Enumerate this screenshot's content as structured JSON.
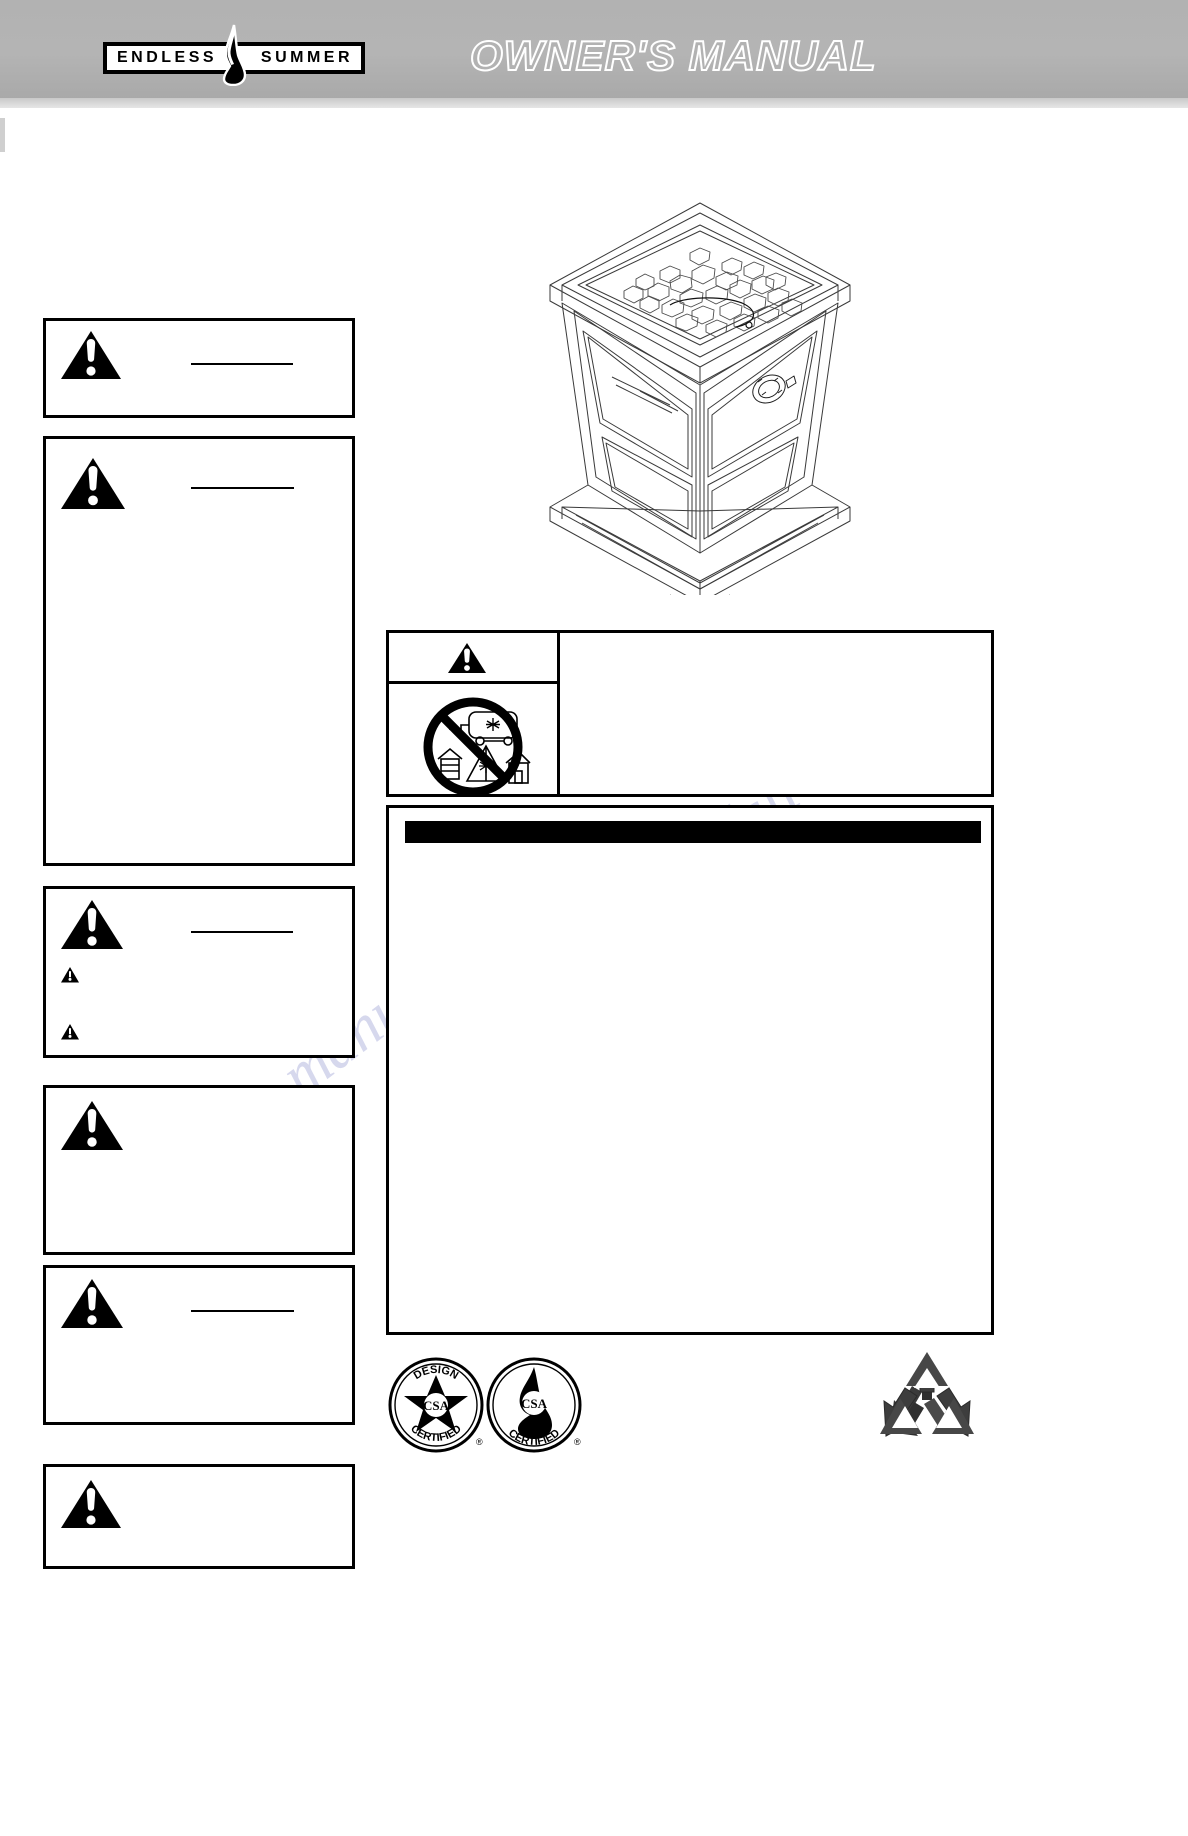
{
  "document": {
    "type": "owner-manual-cover",
    "page_background": "#ffffff"
  },
  "header": {
    "background_color": "#b2b2b2",
    "title": "OWNER'S MANUAL",
    "title_fill": "#b2b2b2",
    "title_outline": "#ffffff",
    "logo": {
      "left_word": "ENDLESS",
      "right_word": "SUMMER",
      "icon": "flame-icon",
      "box_color": "#000000",
      "text_color": "#000000"
    }
  },
  "watermark": {
    "line1": "manualslive.com",
    "line2": ".com",
    "color": "#c9cbe8"
  },
  "left_column": {
    "boxes": [
      {
        "id": "warning-box-1",
        "icon": "warning-triangle-icon",
        "heading_rule": true,
        "heading_text": "",
        "body_text": "",
        "bullets": []
      },
      {
        "id": "warning-box-2",
        "icon": "warning-triangle-icon",
        "heading_rule": true,
        "heading_text": "",
        "body_text": "",
        "bullets": []
      },
      {
        "id": "warning-box-3",
        "icon": "warning-triangle-icon",
        "heading_rule": true,
        "heading_text": "",
        "body_text": "",
        "bullets": [
          {
            "icon": "small-warning-triangle-icon",
            "text": ""
          },
          {
            "icon": "small-warning-triangle-icon",
            "text": ""
          }
        ]
      },
      {
        "id": "warning-box-4",
        "icon": "warning-triangle-icon",
        "heading_rule": false,
        "heading_text": "",
        "body_text": "",
        "bullets": []
      },
      {
        "id": "warning-box-5",
        "icon": "warning-triangle-icon",
        "heading_rule": true,
        "heading_text": "",
        "body_text": "",
        "bullets": []
      },
      {
        "id": "warning-box-6",
        "icon": "warning-triangle-icon",
        "heading_rule": false,
        "heading_text": "",
        "body_text": "",
        "bullets": []
      }
    ]
  },
  "right_column": {
    "illustration": {
      "id": "fire-pit-product-illustration",
      "caption": "",
      "description": "line drawing of square gas fire pit column with lava rock top and control knob"
    },
    "danger_box": {
      "id": "danger-box",
      "icon": "warning-triangle-icon",
      "prohibition_icon": "no-indoor-use-icon",
      "heading_text": "",
      "body_text": ""
    },
    "important_box": {
      "id": "important-box",
      "bar_color": "#000000",
      "bar_text": "",
      "body_text": ""
    }
  },
  "footer": {
    "certifications": [
      {
        "id": "design-certified-badge",
        "top_text": "DESIGN",
        "bottom_text": "CERTIFIED",
        "mark": "CSA",
        "registered": "®"
      },
      {
        "id": "csa-certified-badge",
        "top_text": "",
        "bottom_text": "CERTIFIED",
        "mark": "CSA",
        "registered": "®"
      }
    ],
    "recycle": {
      "id": "recycle-icon",
      "label": ""
    }
  }
}
